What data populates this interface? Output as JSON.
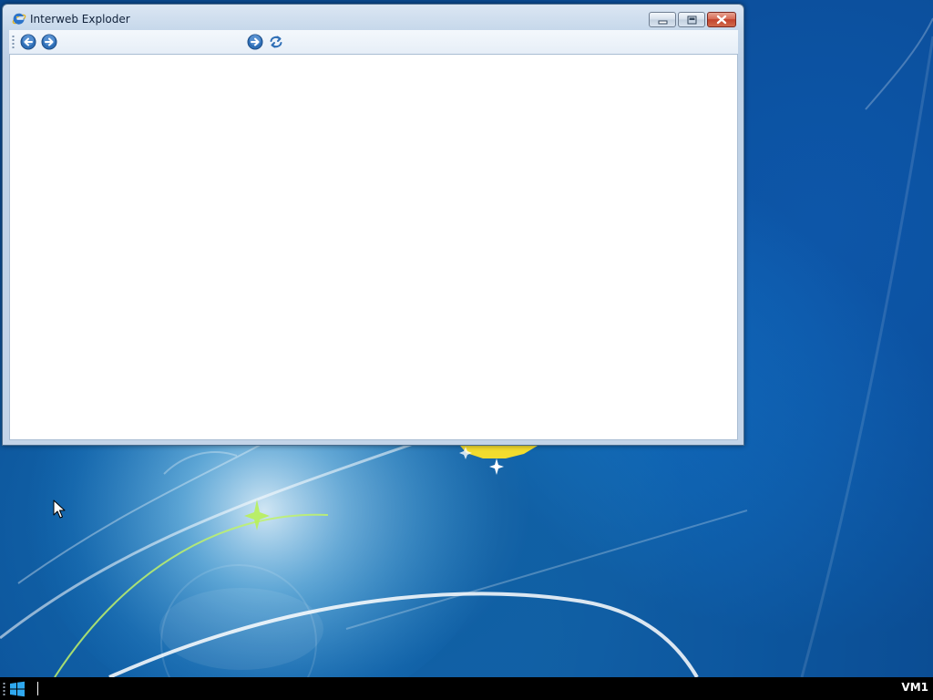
{
  "window": {
    "title": "Interweb Exploder",
    "icon": "internet-explorer-icon"
  },
  "toolbar": {
    "back_icon": "arrow-left-circle-icon",
    "forward_icon": "arrow-right-circle-icon",
    "address_value": "",
    "go_icon": "go-arrow-icon",
    "refresh_icon": "refresh-icon"
  },
  "taskbar": {
    "start_icon": "windows-logo-icon",
    "machine_label": "VM1"
  },
  "colors": {
    "desktop_blue": "#1479cf",
    "taskbar": "#000000",
    "close_red": "#c3432d",
    "nav_blue": "#2f6fb6"
  }
}
